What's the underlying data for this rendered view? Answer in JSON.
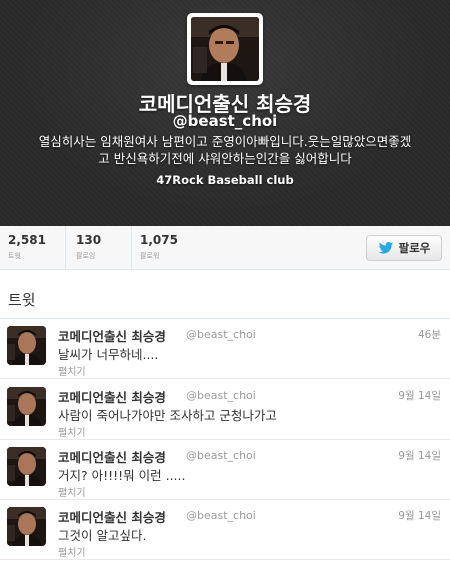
{
  "profile": {
    "display_name": "코메디언출신 최승경",
    "handle": "@beast_choi",
    "bio_line1": "열심히사는 임채원여사 남편이고 준영이아빠입니다.웃는일많았으면좋겠",
    "bio_line2": "고 반신욕하기전에 샤워안하는인간을 싫어합니다",
    "location": "47Rock Baseball club",
    "header_color": "#2a2a2a"
  },
  "stats": {
    "tweets_value": "2,581",
    "tweets_label": "트윗",
    "following_value": "130",
    "following_label": "팔로잉",
    "followers_value": "1,075",
    "followers_label": "팔로워"
  },
  "follow_button": {
    "label": "팔로우",
    "icon": "twitter-bird-icon",
    "icon_color": "#2aa9e0"
  },
  "timeline": {
    "title": "트윗",
    "tweets": [
      {
        "name": "코메디언출신 최승경",
        "handle": "@beast_choi",
        "time": "46분",
        "text": "날씨가 너무하네....",
        "expand": "펼치기"
      },
      {
        "name": "코메디언출신 최승경",
        "handle": "@beast_choi",
        "time": "9월 14일",
        "text": "사람이 죽어나가야만 조사하고 군청나가고",
        "expand": "펼치기"
      },
      {
        "name": "코메디언출신 최승경",
        "handle": "@beast_choi",
        "time": "9월 14일",
        "text": "거지? 아!!!!뭐 이런 .....",
        "expand": "펼치기"
      },
      {
        "name": "코메디언출신 최승경",
        "handle": "@beast_choi",
        "time": "9월 14일",
        "text": "그것이 알고싶다.",
        "expand": "펼치기"
      }
    ]
  }
}
